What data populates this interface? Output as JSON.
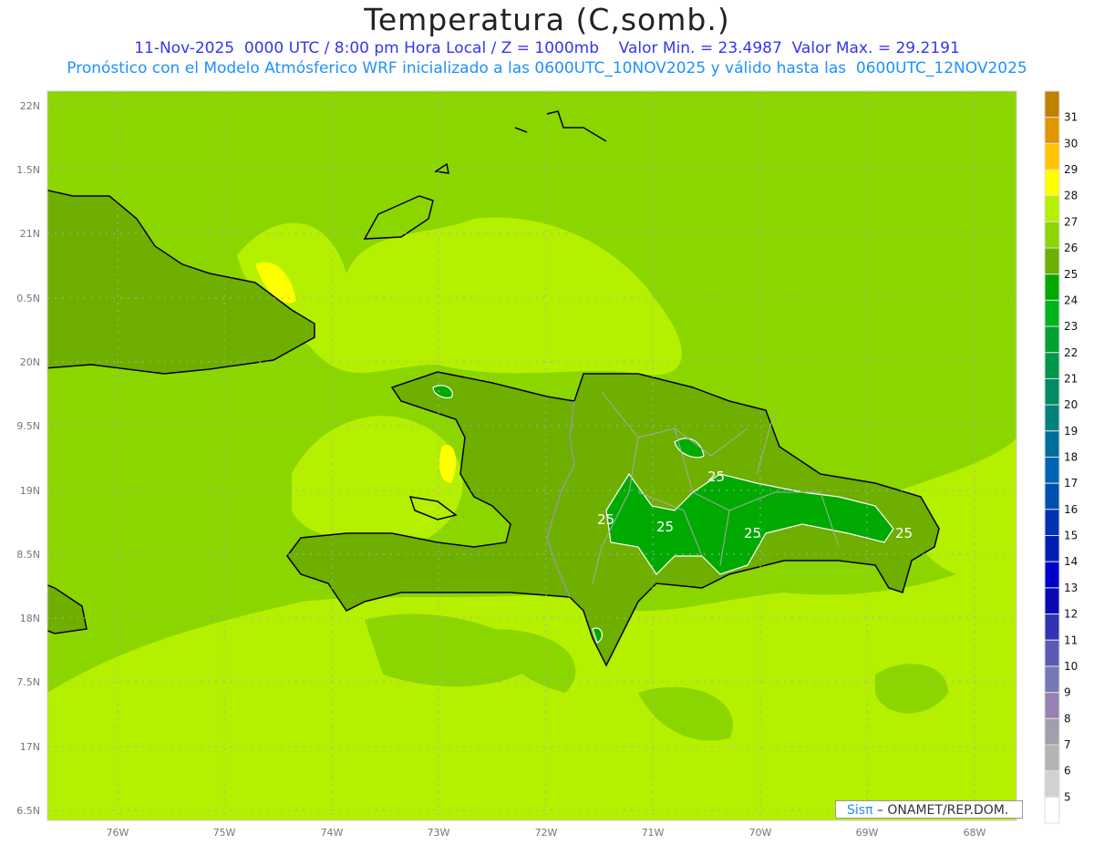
{
  "header": {
    "title": "Temperatura (C,somb.)",
    "subtitle1": "11-Nov-2025  0000 UTC / 8:00 pm Hora Local / Z = 1000mb    Valor Min. = 23.4987  Valor Max. = 29.2191",
    "subtitle2": "Pronóstico con el Modelo Atmósferico WRF inicializado a las 0600UTC_10NOV2025 y válido hasta las  0600UTC_12NOV2025"
  },
  "map": {
    "lon_labels": [
      "76W",
      "75W",
      "74W",
      "73W",
      "72W",
      "71W",
      "70W",
      "69W",
      "68W"
    ],
    "lat_labels": [
      "22N",
      "1.5N",
      "21N",
      "0.5N",
      "20N",
      "9.5N",
      "19N",
      "8.5N",
      "18N",
      "7.5N",
      "17N",
      "6.5N"
    ],
    "contour_labels": [
      "25",
      "25",
      "25",
      "25",
      "25"
    ]
  },
  "colorbar": {
    "labels": [
      "31",
      "30",
      "29",
      "28",
      "27",
      "26",
      "25",
      "24",
      "23",
      "22",
      "21",
      "20",
      "19",
      "18",
      "17",
      "16",
      "15",
      "14",
      "13",
      "12",
      "11",
      "10",
      "9",
      "8",
      "7",
      "6",
      "5"
    ],
    "colors": [
      "#c08000",
      "#e09600",
      "#ffc400",
      "#ffff00",
      "#b4f000",
      "#8cd600",
      "#6eaf00",
      "#00aa00",
      "#00b41e",
      "#00a032",
      "#00964b",
      "#008c64",
      "#00827d",
      "#006e9b",
      "#0064b4",
      "#0050b4",
      "#0032b4",
      "#001eb4",
      "#0000c8",
      "#0a0ab4",
      "#3232b4",
      "#5a5ab4",
      "#7878b4",
      "#9682b4",
      "#a0a0aa",
      "#b4b4b4",
      "#d2d2d2",
      "#ffffff"
    ]
  },
  "credit": {
    "brand": "Sisπ",
    "text": " – ONAMET/REP.DOM."
  }
}
